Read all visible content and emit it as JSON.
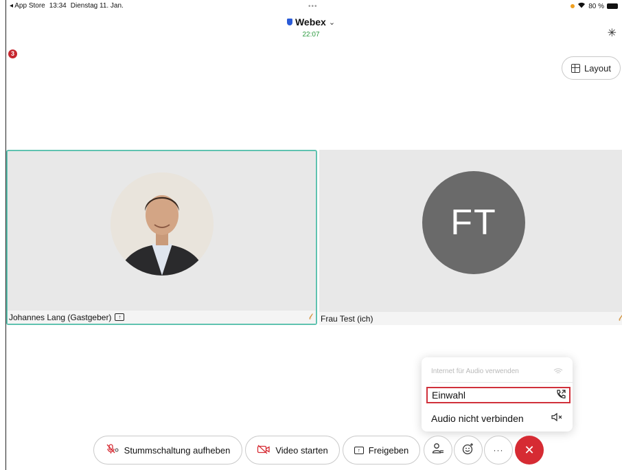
{
  "status_bar": {
    "back_app": "◂ App Store",
    "time": "13:34",
    "date": "Dienstag 11. Jan.",
    "battery": "80 %"
  },
  "header": {
    "grabber": "•••",
    "app_title": "Webex",
    "call_timer": "22:07"
  },
  "notification_badge": "3",
  "layout_button": {
    "label": "Layout"
  },
  "participants": [
    {
      "name": "Johannes Lang (Gastgeber)",
      "active_speaker": true
    },
    {
      "name": "Frau Test (ich)",
      "initials": "FT"
    }
  ],
  "audio_menu": {
    "internet_audio": "Internet für Audio verwenden",
    "dial_in": "Einwahl",
    "no_audio": "Audio nicht verbinden"
  },
  "controls": {
    "unmute": "Stummschaltung aufheben",
    "start_video": "Video starten",
    "share": "Freigeben",
    "more": "···"
  },
  "colors": {
    "accent_green": "#2b9a3f",
    "active_border": "#5fc2b0",
    "end_call": "#d62b33",
    "highlight": "#d0303a"
  }
}
